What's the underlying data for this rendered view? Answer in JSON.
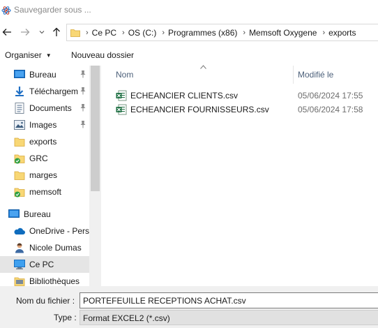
{
  "window": {
    "title": "Sauvegarder sous ..."
  },
  "nav": {
    "back_icon": "arrow-left-icon",
    "forward_icon": "arrow-right-icon",
    "recent_icon": "chevron-down-icon",
    "up_icon": "arrow-up-icon"
  },
  "address": {
    "crumbs": [
      "Ce PC",
      "OS (C:)",
      "Programmes (x86)",
      "Memsoft Oxygene",
      "exports"
    ]
  },
  "toolbar": {
    "organize_label": "Organiser",
    "new_folder_label": "Nouveau dossier"
  },
  "sidebar": {
    "items": [
      {
        "label": "Bureau",
        "icon": "desktop-icon",
        "pinned": true
      },
      {
        "label": "Téléchargements",
        "icon": "download-icon",
        "pinned": true
      },
      {
        "label": "Documents",
        "icon": "documents-icon",
        "pinned": true
      },
      {
        "label": "Images",
        "icon": "images-icon",
        "pinned": true
      },
      {
        "label": "exports",
        "icon": "folder-icon",
        "pinned": false
      },
      {
        "label": "GRC",
        "icon": "synced-folder-icon",
        "pinned": false
      },
      {
        "label": "marges",
        "icon": "folder-icon",
        "pinned": false
      },
      {
        "label": "memsoft",
        "icon": "synced-folder-icon",
        "pinned": false
      },
      {
        "label": "Bureau",
        "icon": "desktop-icon",
        "pinned": false
      },
      {
        "label": "OneDrive - Personnel",
        "icon": "onedrive-icon",
        "pinned": false
      },
      {
        "label": "Nicole Dumas",
        "icon": "user-icon",
        "pinned": false
      },
      {
        "label": "Ce PC",
        "icon": "computer-icon",
        "pinned": false,
        "selected": true
      },
      {
        "label": "Bibliothèques",
        "icon": "library-icon",
        "pinned": false
      }
    ]
  },
  "file_list": {
    "columns": {
      "name": "Nom",
      "modified": "Modifié le"
    },
    "files": [
      {
        "name": "ECHEANCIER CLIENTS.csv",
        "modified": "05/06/2024 17:55",
        "icon": "excel-csv-icon"
      },
      {
        "name": "ECHEANCIER FOURNISSEURS.csv",
        "modified": "05/06/2024 17:58",
        "icon": "excel-csv-icon"
      }
    ]
  },
  "form": {
    "filename_label": "Nom du fichier :",
    "filename_value": "PORTEFEUILLE RECEPTIONS ACHAT.csv",
    "type_label": "Type :",
    "type_value": "Format EXCEL2 (*.csv)"
  },
  "colors": {
    "accent_blue": "#0078d4",
    "folder_yellow": "#f8d775",
    "excel_green": "#1d6f42",
    "sync_green": "#2ea043"
  }
}
